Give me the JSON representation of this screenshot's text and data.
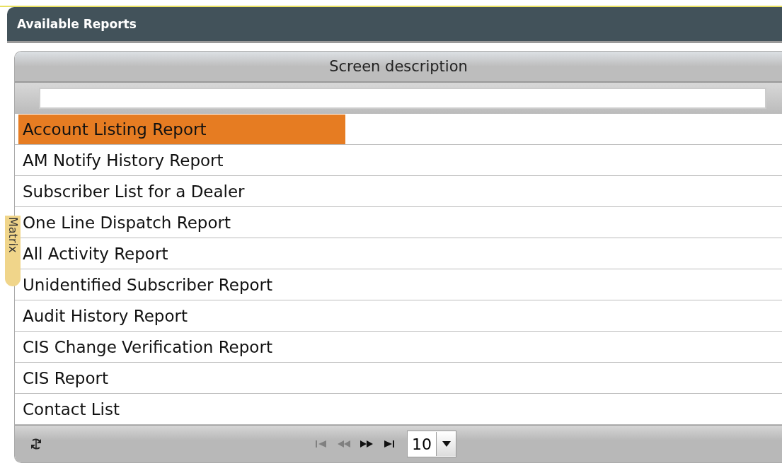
{
  "window": {
    "title": "Available Reports"
  },
  "side_tab": {
    "label": "Matrix"
  },
  "table": {
    "columns": [
      "Screen description"
    ],
    "rows": [
      {
        "label": "Account Listing Report",
        "selected": true
      },
      {
        "label": "AM Notify History Report",
        "selected": false
      },
      {
        "label": "Subscriber List for a Dealer",
        "selected": false
      },
      {
        "label": "One Line Dispatch Report",
        "selected": false
      },
      {
        "label": "All Activity Report",
        "selected": false
      },
      {
        "label": "Unidentified Subscriber Report",
        "selected": false
      },
      {
        "label": "Audit History Report",
        "selected": false
      },
      {
        "label": "CIS Change Verification Report",
        "selected": false
      },
      {
        "label": "CIS Report",
        "selected": false
      },
      {
        "label": "Contact List",
        "selected": false
      }
    ]
  },
  "pager": {
    "nav": [
      {
        "kind": "first",
        "disabled": true
      },
      {
        "kind": "prev",
        "disabled": true
      },
      {
        "kind": "next",
        "disabled": false
      },
      {
        "kind": "last",
        "disabled": false
      }
    ],
    "page_size": "10"
  }
}
